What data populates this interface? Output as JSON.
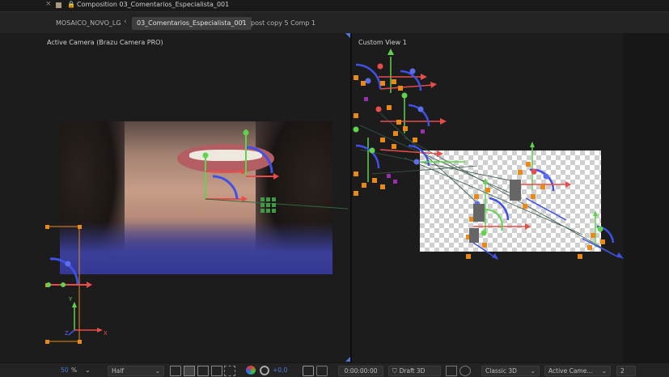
{
  "title_bar": {
    "close_glyph": "×",
    "lock_glyph": "🔒",
    "title": "Composition 03_Comentarios_Especialista_001",
    "swatch_color": "#a89a7f"
  },
  "tabs": [
    {
      "label": "MOSAICO_NOVO_LG",
      "active": false
    },
    {
      "label": "03_Comentarios_Especialista_001",
      "active": true
    },
    {
      "label": "post copy 5 Comp 1",
      "active": false
    }
  ],
  "tab_chevron": "‹",
  "viewers": {
    "left": {
      "label": "Active Camera (Brazu Camera PRO)"
    },
    "right": {
      "label": "Custom View 1"
    }
  },
  "axis_labels": {
    "x": "X",
    "y": "Y",
    "z": "Z"
  },
  "bottom_bar": {
    "zoom_value": "50",
    "zoom_unit": "%",
    "resolution": "Half",
    "exposure": "+0,0",
    "timecode": "0:00:00:00",
    "draft_3d": "Draft 3D",
    "renderer": "Classic 3D",
    "view": "Active Came...",
    "views_count": "2",
    "icons": [
      "fit-icon",
      "transparency-grid-icon",
      "mask-icon",
      "region-of-interest-icon",
      "grid-icon",
      "color-channels-icon",
      "exposure-reset-icon",
      "snapshot-camera-icon",
      "show-snapshot-icon",
      "draft3d-icon",
      "layer-controls-icon"
    ]
  },
  "colors": {
    "accent_blue": "#4d7ad8",
    "gizmo_red": "#ea4c4c",
    "gizmo_green": "#5fd34d",
    "gizmo_blue": "#3f51e6",
    "handle_orange": "#e88a1a",
    "handle_purple": "#9b2fb0"
  }
}
